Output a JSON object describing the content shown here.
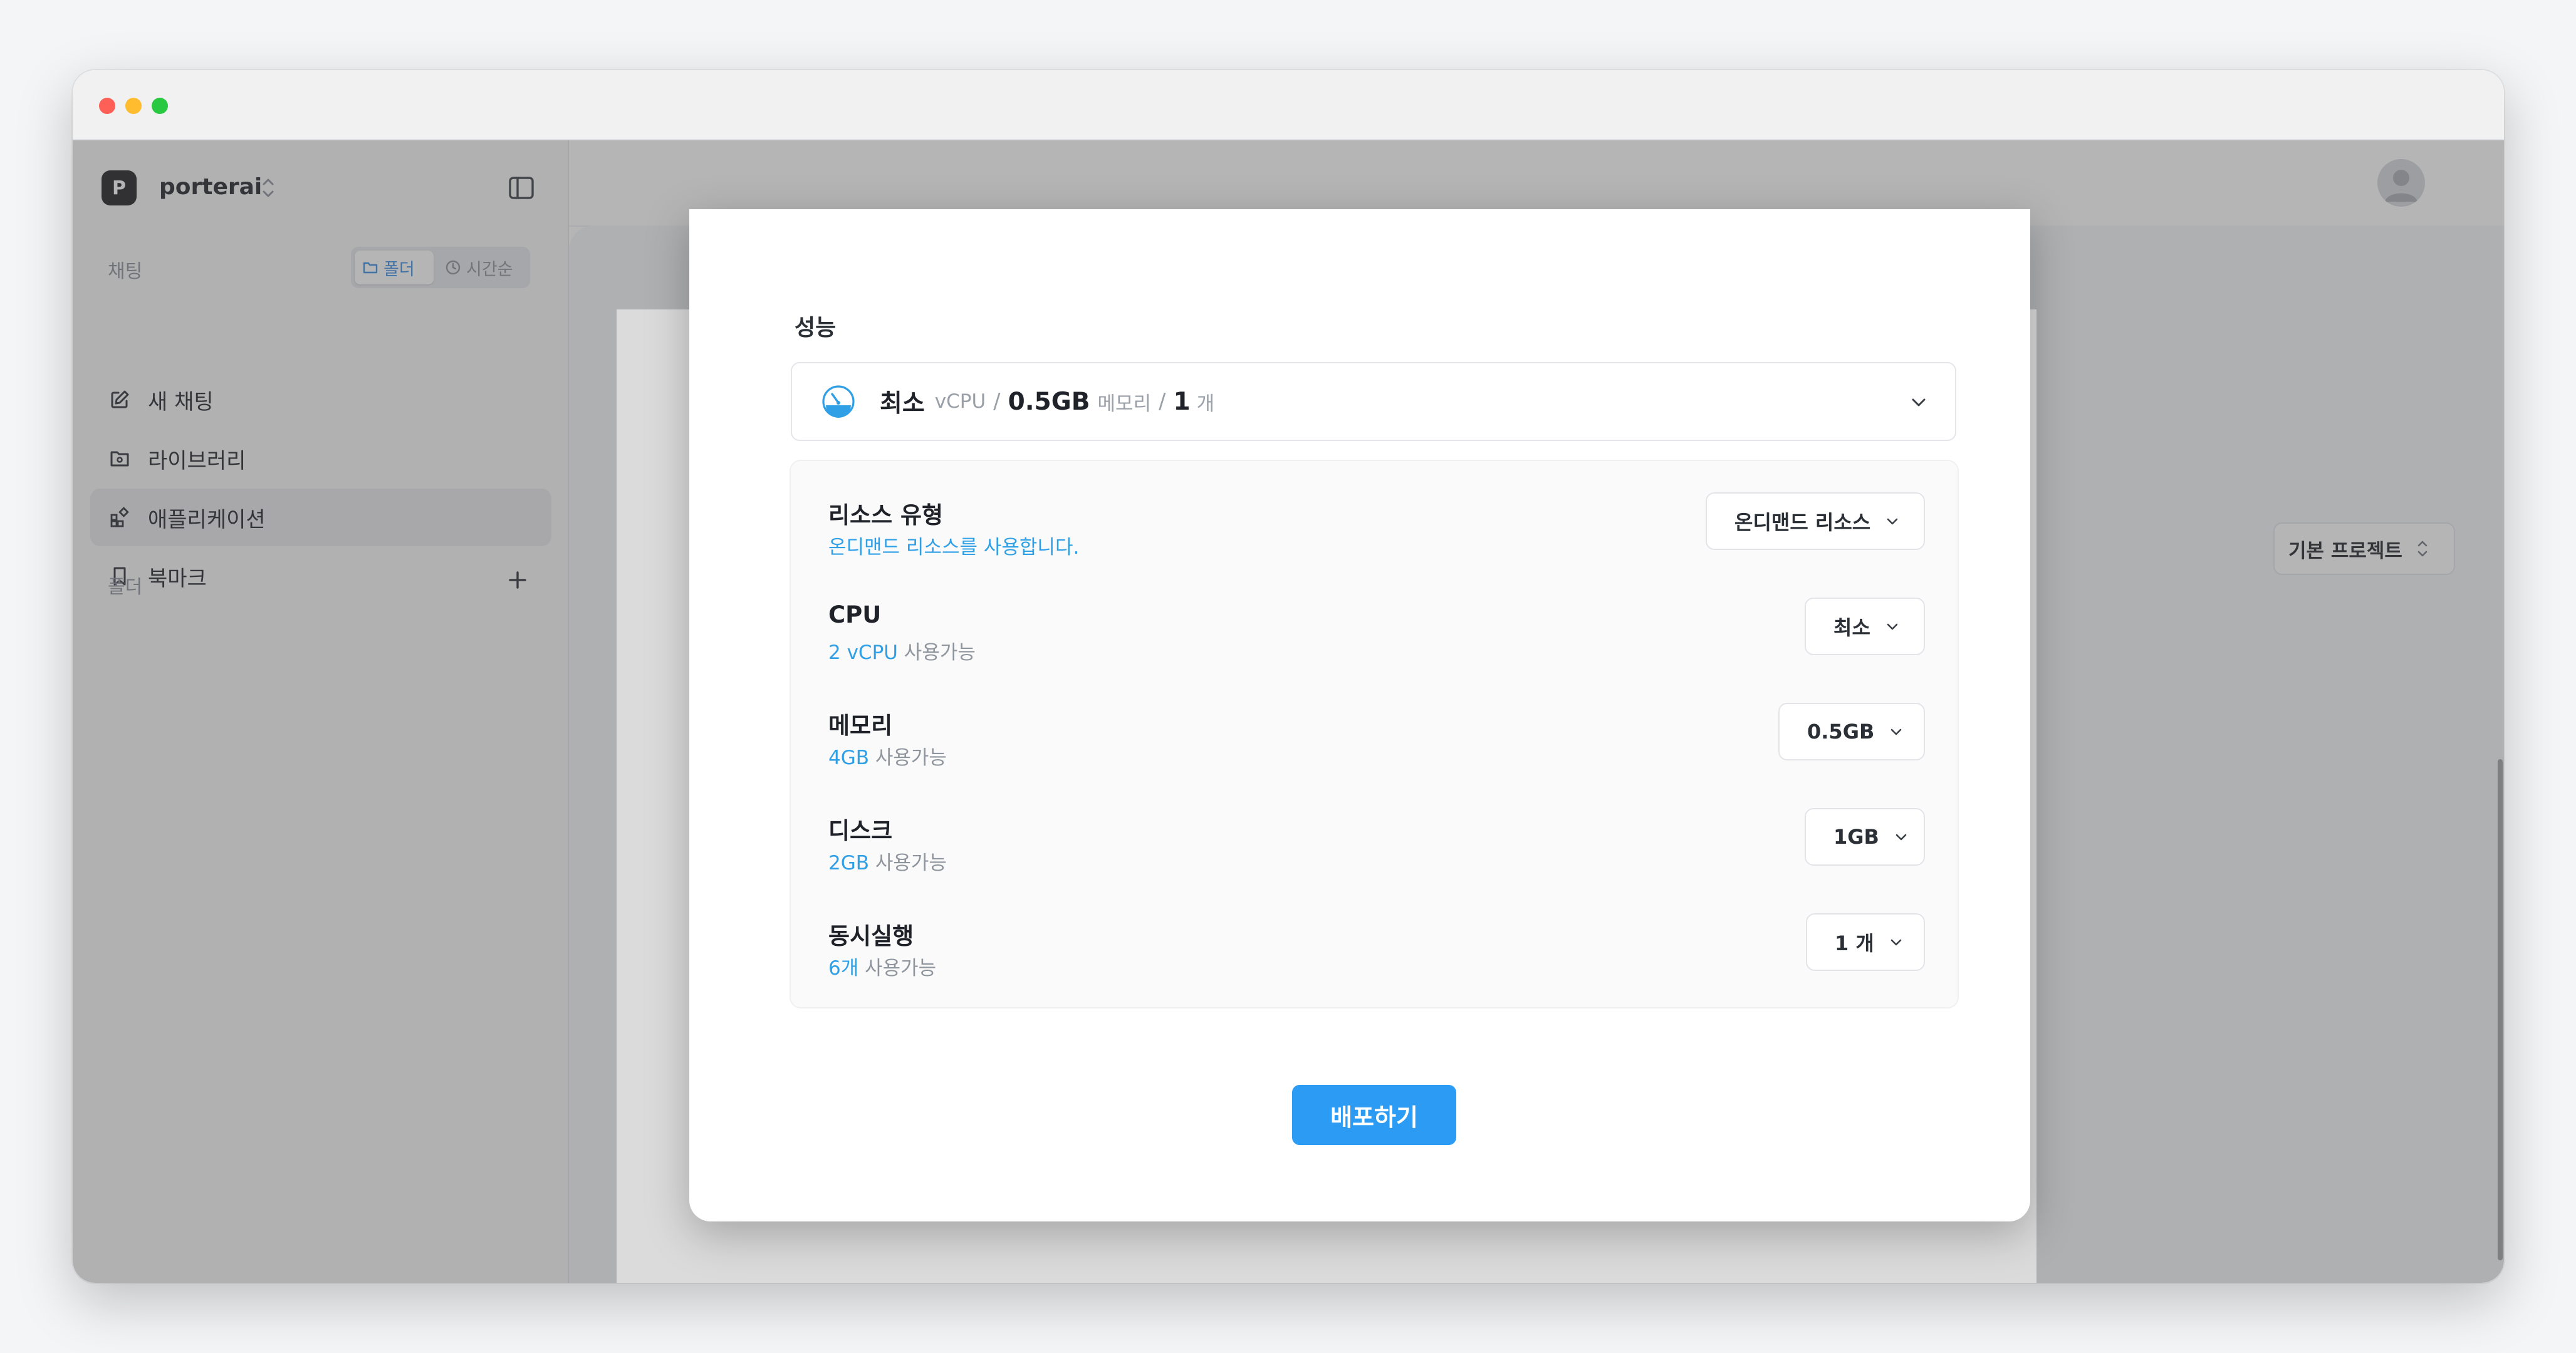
{
  "window": {
    "traffic_lights": [
      "close",
      "minimize",
      "zoom"
    ]
  },
  "sidebar": {
    "workspace_initial": "P",
    "workspace_name": "porterai",
    "chat_section_label": "채팅",
    "view_toggle": {
      "folder_label": "폴더",
      "time_label": "시간순"
    },
    "items": [
      {
        "label": "새 채팅",
        "icon": "edit-icon"
      },
      {
        "label": "라이브러리",
        "icon": "library-icon"
      },
      {
        "label": "애플리케이션",
        "icon": "apps-icon",
        "active": true
      },
      {
        "label": "북마크",
        "icon": "bookmark-icon"
      }
    ],
    "folder_section_label": "폴더"
  },
  "main": {
    "preset_select_value": "기본 프로젝트"
  },
  "modal": {
    "section_title": "성능",
    "summary": {
      "tier": "최소",
      "cpu_unit": "vCPU",
      "memory_value": "0.5GB",
      "memory_unit": "메모리",
      "count_value": "1",
      "count_unit": "개",
      "separator": "/"
    },
    "rows": [
      {
        "label": "리소스 유형",
        "hint_highlight": "온디맨드 리소스를 사용합니다.",
        "hint_rest": "",
        "select_value": "온디맨드 리소스"
      },
      {
        "label": "CPU",
        "hint_highlight": "2 vCPU",
        "hint_rest": " 사용가능",
        "select_value": "최소"
      },
      {
        "label": "메모리",
        "hint_highlight": "4GB",
        "hint_rest": " 사용가능",
        "select_value": "0.5GB"
      },
      {
        "label": "디스크",
        "hint_highlight": "2GB",
        "hint_rest": " 사용가능",
        "select_value": "1GB"
      },
      {
        "label": "동시실행",
        "hint_highlight": "6개",
        "hint_rest": " 사용가능",
        "select_value": "1 개"
      }
    ],
    "deploy_button_label": "배포하기"
  },
  "colors": {
    "accent": "#2b9bf4",
    "hint_highlight": "#2f9fe6",
    "overlay": "rgba(78,78,80,0.42)"
  }
}
